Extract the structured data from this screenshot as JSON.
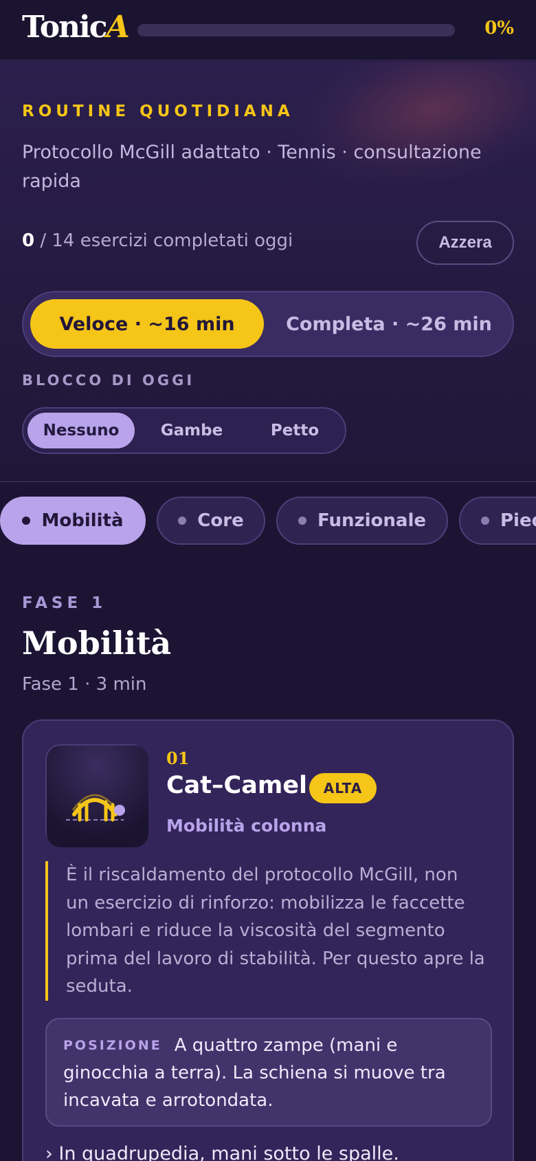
{
  "header": {
    "logo_main": "Tonic",
    "logo_accent": "A",
    "progress_percent": 0,
    "progress_label": "0%"
  },
  "hero": {
    "eyebrow": "ROUTINE QUOTIDIANA",
    "subtitle": "Protocollo McGill adattato · Tennis · consultazione rapida",
    "completed_count": "0",
    "completed_suffix": " / 14 esercizi completati oggi",
    "reset_label": "Azzera",
    "modes": [
      {
        "label": "Veloce · ~16 min",
        "active": true
      },
      {
        "label": "Completa · ~26 min",
        "active": false
      }
    ],
    "block_label": "BLOCCO DI OGGI",
    "blocks": [
      {
        "label": "Nessuno",
        "active": true
      },
      {
        "label": "Gambe",
        "active": false
      },
      {
        "label": "Petto",
        "active": false
      }
    ]
  },
  "tabs": [
    {
      "label": "Mobilità",
      "active": true
    },
    {
      "label": "Core",
      "active": false
    },
    {
      "label": "Funzionale",
      "active": false
    },
    {
      "label": "Piedi",
      "active": false
    }
  ],
  "phase": {
    "eyebrow": "FASE 1",
    "title": "Mobilità",
    "meta": "Fase 1 · 3 min"
  },
  "exercise": {
    "number": "01",
    "name": "Cat–Camel",
    "badge": "ALTA",
    "category": "Mobilità colonna",
    "description": "È il riscaldamento del protocollo McGill, non un esercizio di rinforzo: mobilizza le faccette lombari e riduce la viscosità del segmento prima del lavoro di stabilità. Per questo apre la seduta.",
    "position_label": "POSIZIONE",
    "position_text": "A quattro zampe (mani e ginocchia a terra). La schiena si muove tra incavata e arrotondata.",
    "first_step": "› In quadrupedia, mani sotto le spalle.",
    "thumb_icon": "cat-camel-illustration"
  },
  "colors": {
    "accent": "#f5c518",
    "lavender": "#b9a3ea",
    "background": "#1c1433",
    "card": "#33255a"
  }
}
